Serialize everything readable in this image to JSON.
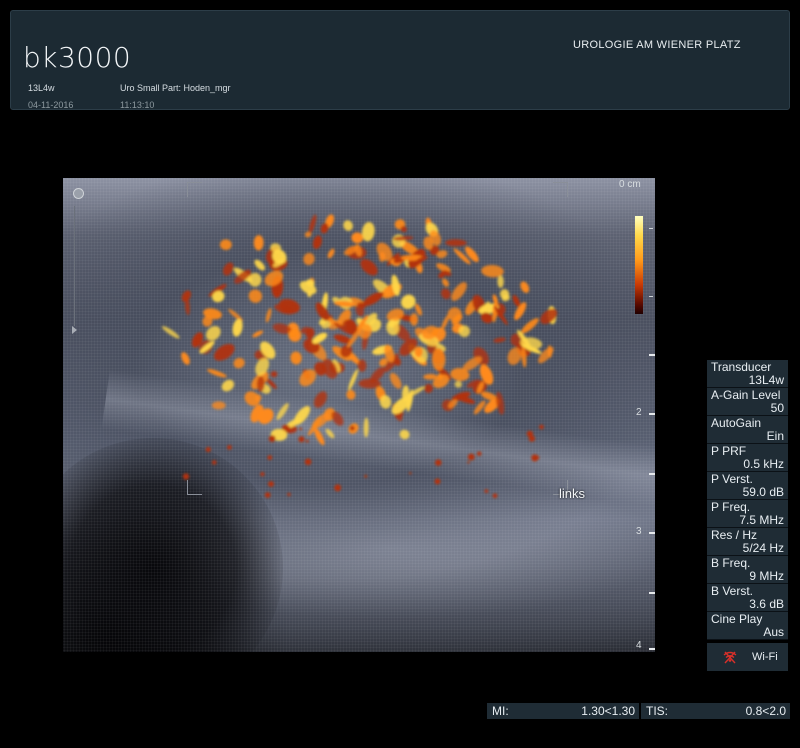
{
  "header": {
    "brand": "bk3000",
    "probe": "13L4w",
    "preset": "Uro Small Part: Hoden_mgr",
    "date": "04-11-2016",
    "time": "11:13:10",
    "institution": "UROLOGIE AM WIENER PLATZ"
  },
  "image": {
    "depth_unit": "0 cm",
    "depth_marks": [
      "2",
      "3",
      "4"
    ],
    "annotation": "links"
  },
  "params": [
    {
      "name": "Transducer",
      "value": "13L4w"
    },
    {
      "name": "A-Gain Level",
      "value": "50"
    },
    {
      "name": "AutoGain",
      "value": "Ein"
    },
    {
      "name": "P PRF",
      "value": "0.5 kHz"
    },
    {
      "name": "P Verst.",
      "value": "59.0 dB"
    },
    {
      "name": "P Freq.",
      "value": "7.5 MHz"
    },
    {
      "name": "Res / Hz",
      "value": "5/24 Hz"
    },
    {
      "name": "B Freq.",
      "value": "9 MHz"
    },
    {
      "name": "B Verst.",
      "value": "3.6 dB"
    },
    {
      "name": "Cine Play",
      "value": "Aus"
    }
  ],
  "wifi": {
    "label": "Wi-Fi",
    "icon": "wifi-disabled-icon"
  },
  "readouts": {
    "mi_label": "MI:",
    "mi_value": "1.30<1.30",
    "tis_label": "TIS:",
    "tis_value": "0.8<2.0"
  },
  "colors": {
    "panel_bg": "#1f2c35",
    "header_bg": "#1c2a33",
    "doppler_hot": "#ffd84a",
    "doppler_mid": "#ff8a1a",
    "doppler_low": "#b2320a"
  }
}
